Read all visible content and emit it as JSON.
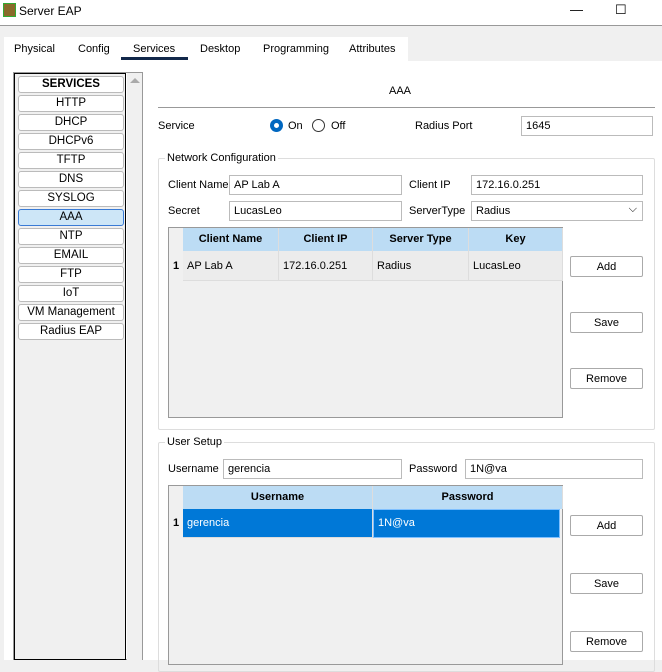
{
  "window": {
    "title": "Server EAP",
    "minimize": "—",
    "maximize": "☐"
  },
  "tabs": [
    "Physical",
    "Config",
    "Services",
    "Desktop",
    "Programming",
    "Attributes"
  ],
  "active_tab": "Services",
  "sidebar": {
    "items": [
      "SERVICES",
      "HTTP",
      "DHCP",
      "DHCPv6",
      "TFTP",
      "DNS",
      "SYSLOG",
      "AAA",
      "NTP",
      "EMAIL",
      "FTP",
      "IoT",
      "VM Management",
      "Radius EAP"
    ],
    "selected": "AAA"
  },
  "main": {
    "heading": "AAA",
    "service_label": "Service",
    "on_label": "On",
    "off_label": "Off",
    "service_state": "On",
    "radius_port_label": "Radius Port",
    "radius_port": "1645",
    "network": {
      "legend": "Network Configuration",
      "client_name_label": "Client Name",
      "client_name": "AP Lab A",
      "client_ip_label": "Client IP",
      "client_ip": "172.16.0.251",
      "secret_label": "Secret",
      "secret": "LucasLeo",
      "server_type_label": "ServerType",
      "server_type": "Radius",
      "columns": [
        "Client Name",
        "Client IP",
        "Server Type",
        "Key"
      ],
      "rows": [
        {
          "n": "1",
          "cells": [
            "AP Lab A",
            "172.16.0.251",
            "Radius",
            "LucasLeo"
          ]
        }
      ],
      "add": "Add",
      "save": "Save",
      "remove": "Remove"
    },
    "users": {
      "legend": "User Setup",
      "username_label": "Username",
      "username": "gerencia",
      "password_label": "Password",
      "password": "1N@va",
      "columns": [
        "Username",
        "Password"
      ],
      "rows": [
        {
          "n": "1",
          "cells": [
            "gerencia",
            "1N@va"
          ]
        }
      ],
      "add": "Add",
      "save": "Save",
      "remove": "Remove"
    },
    "colors": {
      "header": "#bcdcf4",
      "selection": "#0078d7",
      "radio": "#0067c0"
    }
  }
}
